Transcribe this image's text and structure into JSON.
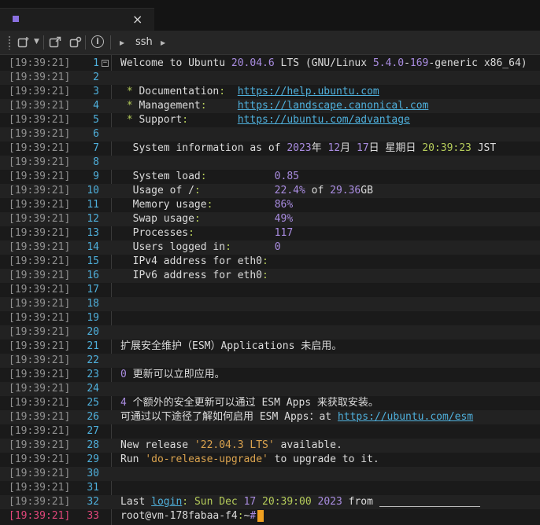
{
  "tab": {
    "close_glyph": "×"
  },
  "toolbar": {
    "ssh_label": "ssh"
  },
  "timestamp": "[19:39:21]",
  "lines": [
    {
      "n": "1",
      "segs": [
        [
          "Welcome to Ubuntu ",
          ""
        ],
        [
          "20.04.6",
          "purple"
        ],
        [
          " LTS (GNU/Linux ",
          ""
        ],
        [
          "5.4.0",
          "purple"
        ],
        [
          "-",
          ""
        ],
        [
          "169",
          "purple"
        ],
        [
          "-generic x86_64)",
          ""
        ]
      ]
    },
    {
      "n": "2",
      "segs": []
    },
    {
      "n": "3",
      "segs": [
        [
          " * ",
          "green"
        ],
        [
          "Documentation",
          ""
        ],
        [
          ":",
          "green"
        ],
        [
          "  ",
          ""
        ],
        [
          "https://help.ubuntu.com",
          "link"
        ]
      ]
    },
    {
      "n": "4",
      "segs": [
        [
          " * ",
          "green"
        ],
        [
          "Management",
          ""
        ],
        [
          ":",
          "green"
        ],
        [
          "     ",
          ""
        ],
        [
          "https://landscape.canonical.com",
          "link"
        ]
      ]
    },
    {
      "n": "5",
      "segs": [
        [
          " * ",
          "green"
        ],
        [
          "Support",
          ""
        ],
        [
          ":",
          "green"
        ],
        [
          "        ",
          ""
        ],
        [
          "https://ubuntu.com/advantage",
          "link"
        ]
      ]
    },
    {
      "n": "6",
      "segs": []
    },
    {
      "n": "7",
      "segs": [
        [
          "  System information as of ",
          ""
        ],
        [
          "2023",
          "purple"
        ],
        [
          "年 ",
          ""
        ],
        [
          "12",
          "purple"
        ],
        [
          "月 ",
          ""
        ],
        [
          "17",
          "purple"
        ],
        [
          "日 星期日 ",
          ""
        ],
        [
          "20:39:23",
          "green"
        ],
        [
          " JST",
          ""
        ]
      ]
    },
    {
      "n": "8",
      "segs": []
    },
    {
      "n": "9",
      "segs": [
        [
          "  System load",
          ""
        ],
        [
          ":",
          "green"
        ],
        [
          "           ",
          ""
        ],
        [
          "0.85",
          "purple"
        ]
      ]
    },
    {
      "n": "10",
      "segs": [
        [
          "  Usage of /",
          ""
        ],
        [
          ":",
          "green"
        ],
        [
          "            ",
          ""
        ],
        [
          "22.4%",
          "purple"
        ],
        [
          " of ",
          ""
        ],
        [
          "29.36",
          "purple"
        ],
        [
          "GB",
          ""
        ]
      ]
    },
    {
      "n": "11",
      "segs": [
        [
          "  Memory usage",
          ""
        ],
        [
          ":",
          "green"
        ],
        [
          "          ",
          ""
        ],
        [
          "86%",
          "purple"
        ]
      ]
    },
    {
      "n": "12",
      "segs": [
        [
          "  Swap usage",
          ""
        ],
        [
          ":",
          "green"
        ],
        [
          "            ",
          ""
        ],
        [
          "49%",
          "purple"
        ]
      ]
    },
    {
      "n": "13",
      "segs": [
        [
          "  Processes",
          ""
        ],
        [
          ":",
          "green"
        ],
        [
          "             ",
          ""
        ],
        [
          "117",
          "purple"
        ]
      ]
    },
    {
      "n": "14",
      "segs": [
        [
          "  Users logged in",
          ""
        ],
        [
          ":",
          "green"
        ],
        [
          "       ",
          ""
        ],
        [
          "0",
          "purple"
        ]
      ]
    },
    {
      "n": "15",
      "segs": [
        [
          "  IPv4 address for eth0",
          ""
        ],
        [
          ":",
          "green"
        ]
      ]
    },
    {
      "n": "16",
      "segs": [
        [
          "  IPv6 address for eth0",
          ""
        ],
        [
          ":",
          "green"
        ]
      ]
    },
    {
      "n": "17",
      "segs": []
    },
    {
      "n": "18",
      "segs": []
    },
    {
      "n": "19",
      "segs": []
    },
    {
      "n": "20",
      "segs": []
    },
    {
      "n": "21",
      "segs": [
        [
          "扩展安全维护（ESM）Applications 未启用。",
          ""
        ]
      ]
    },
    {
      "n": "22",
      "segs": []
    },
    {
      "n": "23",
      "segs": [
        [
          "0",
          "purple"
        ],
        [
          " 更新可以立即应用。",
          ""
        ]
      ]
    },
    {
      "n": "24",
      "segs": []
    },
    {
      "n": "25",
      "segs": [
        [
          "4",
          "purple"
        ],
        [
          " 个额外的安全更新可以通过 ESM Apps 来获取安装。",
          ""
        ]
      ]
    },
    {
      "n": "26",
      "segs": [
        [
          "可通过以下途径了解如何启用 ESM Apps：at ",
          ""
        ],
        [
          "https://ubuntu.com/esm",
          "link"
        ]
      ]
    },
    {
      "n": "27",
      "segs": []
    },
    {
      "n": "28",
      "segs": [
        [
          "New release ",
          ""
        ],
        [
          "'22.04.3 LTS'",
          "orange"
        ],
        [
          " available.",
          ""
        ]
      ]
    },
    {
      "n": "29",
      "segs": [
        [
          "Run ",
          ""
        ],
        [
          "'do-release-upgrade'",
          "orange"
        ],
        [
          " to upgrade to it.",
          ""
        ]
      ]
    },
    {
      "n": "30",
      "segs": []
    },
    {
      "n": "31",
      "segs": []
    },
    {
      "n": "32",
      "segs": [
        [
          "Last ",
          ""
        ],
        [
          "login",
          "link"
        ],
        [
          ": ",
          "green"
        ],
        [
          "Sun Dec ",
          "green"
        ],
        [
          "17",
          "purple"
        ],
        [
          " ",
          ""
        ],
        [
          "20:39:00",
          "green"
        ],
        [
          " ",
          ""
        ],
        [
          "2023",
          "purple"
        ],
        [
          " from ",
          ""
        ]
      ]
    },
    {
      "n": "33",
      "segs": [
        [
          "root@vm-178fabaa-f4",
          ""
        ],
        [
          ":",
          "green"
        ],
        [
          "~",
          ""
        ],
        [
          "#",
          "purple"
        ]
      ]
    }
  ],
  "colors": {
    "timestamp": "#8f8f8f",
    "line_number": "#4fb0dc",
    "current_line": "#e0467a",
    "cursor": "#f0a020"
  },
  "icons": [
    "new-session-icon",
    "dropdown-icon",
    "external-window-icon",
    "duplicate-icon",
    "info-icon",
    "play-icon"
  ]
}
